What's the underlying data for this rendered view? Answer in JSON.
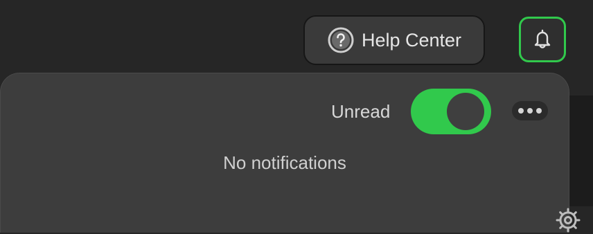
{
  "header": {
    "help_center_label": "Help Center",
    "help_icon": "question-circle-icon",
    "notifications_icon": "bell-icon"
  },
  "notifications_panel": {
    "filter_label": "Unread",
    "unread_toggle_on": true,
    "more_icon": "more-horizontal-icon",
    "empty_message": "No notifications"
  },
  "colors": {
    "accent": "#31c94c",
    "panel_bg": "#3d3d3d",
    "page_bg": "#262626"
  }
}
